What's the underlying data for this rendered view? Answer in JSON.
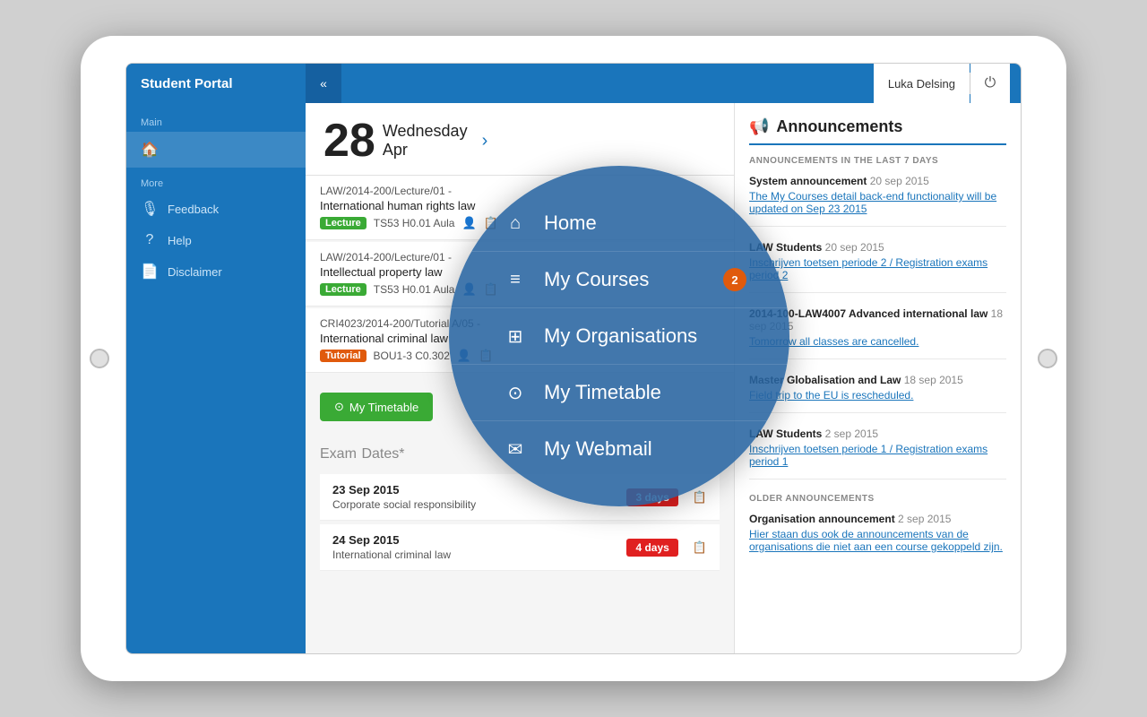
{
  "app": {
    "title": "Student Portal",
    "collapse_btn": "«"
  },
  "header": {
    "user": "Luka Delsing",
    "power_icon": "⏻"
  },
  "sidebar": {
    "main_label": "Main",
    "more_label": "More",
    "items_main": [
      {
        "id": "home",
        "label": "Home",
        "icon": "🏠",
        "badge": null
      },
      {
        "id": "courses",
        "label": "My Courses",
        "icon": "📋",
        "badge": "2"
      },
      {
        "id": "organisations",
        "label": "My Organisations",
        "icon": "🏛",
        "badge": null
      },
      {
        "id": "timetable",
        "label": "My Timetable",
        "icon": "🕐",
        "badge": null
      }
    ],
    "items_more": [
      {
        "id": "feedback",
        "label": "Feedback",
        "icon": "🎙"
      },
      {
        "id": "help",
        "label": "Help",
        "icon": "?"
      },
      {
        "id": "disclaimer",
        "label": "Disclaimer",
        "icon": "📄"
      }
    ]
  },
  "nav_overlay": {
    "items": [
      {
        "id": "home",
        "label": "Home",
        "icon": "⌂",
        "badge": null
      },
      {
        "id": "courses",
        "label": "My Courses",
        "icon": "≡",
        "badge": "2"
      },
      {
        "id": "organisations",
        "label": "My Organisations",
        "icon": "⊞",
        "badge": null
      },
      {
        "id": "timetable",
        "label": "My Timetable",
        "icon": "⊙",
        "badge": null
      },
      {
        "id": "webmail",
        "label": "My Webmail",
        "icon": "✉",
        "badge": null
      }
    ]
  },
  "timetable": {
    "date_num": "28",
    "day": "Wednesday",
    "month": "Apr",
    "nav_arrow": "›",
    "events": [
      {
        "code": "LAW/2014-200/Lecture/01 -",
        "title": "International human rights law",
        "tag": "Lecture",
        "tag_type": "lecture",
        "location": "TS53 H0.01 Aula",
        "has_user": true,
        "has_book": true
      },
      {
        "code": "LAW/2014-200/Lecture/01 -",
        "title": "Intellectual property law",
        "tag": "Lecture",
        "tag_type": "lecture",
        "location": "TS53 H0.01 Aula",
        "has_user": true,
        "has_book": true
      },
      {
        "code": "CRI4023/2014-200/Tutorial A/05 -",
        "title": "International criminal law",
        "tag": "Tutorial",
        "tag_type": "tutorial",
        "location": "BOU1-3 C0.302",
        "has_user": true,
        "has_book": true
      }
    ],
    "timetable_btn": "My Timetable",
    "exam_title": "Exam",
    "exam_subtitle": "Dates*",
    "exam_rows": [
      {
        "date": "23 Sep 2015",
        "name": "Corporate social responsibility",
        "badge": "3 days",
        "badge_color": "red"
      },
      {
        "date": "24 Sep 2015",
        "name": "International criminal law",
        "badge": "4 days",
        "badge_color": "red"
      }
    ]
  },
  "announcements": {
    "title": "Announcements",
    "icon": "📢",
    "section_label": "ANNOUNCEMENTS IN THE LAST 7 DAYS",
    "older_label": "OLDER ANNOUNCEMENTS",
    "items": [
      {
        "sender": "System announcement",
        "date": "20 sep 2015",
        "link": "The My Courses detail back-end functionality will be updated on Sep 23 2015"
      },
      {
        "sender": "LAW Students",
        "date": "20 sep 2015",
        "link": "Inschrijven toetsen periode 2 / Registration exams period 2"
      },
      {
        "sender": "2014-100-LAW4007 Advanced international law",
        "date": "18 sep 2015",
        "link": "Tomorrow all classes are cancelled."
      },
      {
        "sender": "Master Globalisation and Law",
        "date": "18 sep 2015",
        "link": "Field trip to the EU is rescheduled."
      },
      {
        "sender": "LAW Students",
        "date": "2 sep 2015",
        "link": "Inschrijven toetsen periode 1 / Registration exams period 1"
      }
    ],
    "older_items": [
      {
        "sender": "Organisation announcement",
        "date": "2 sep 2015",
        "link": "Hier staan dus ook de announcements van de organisations die niet aan een course gekoppeld zijn."
      }
    ]
  }
}
